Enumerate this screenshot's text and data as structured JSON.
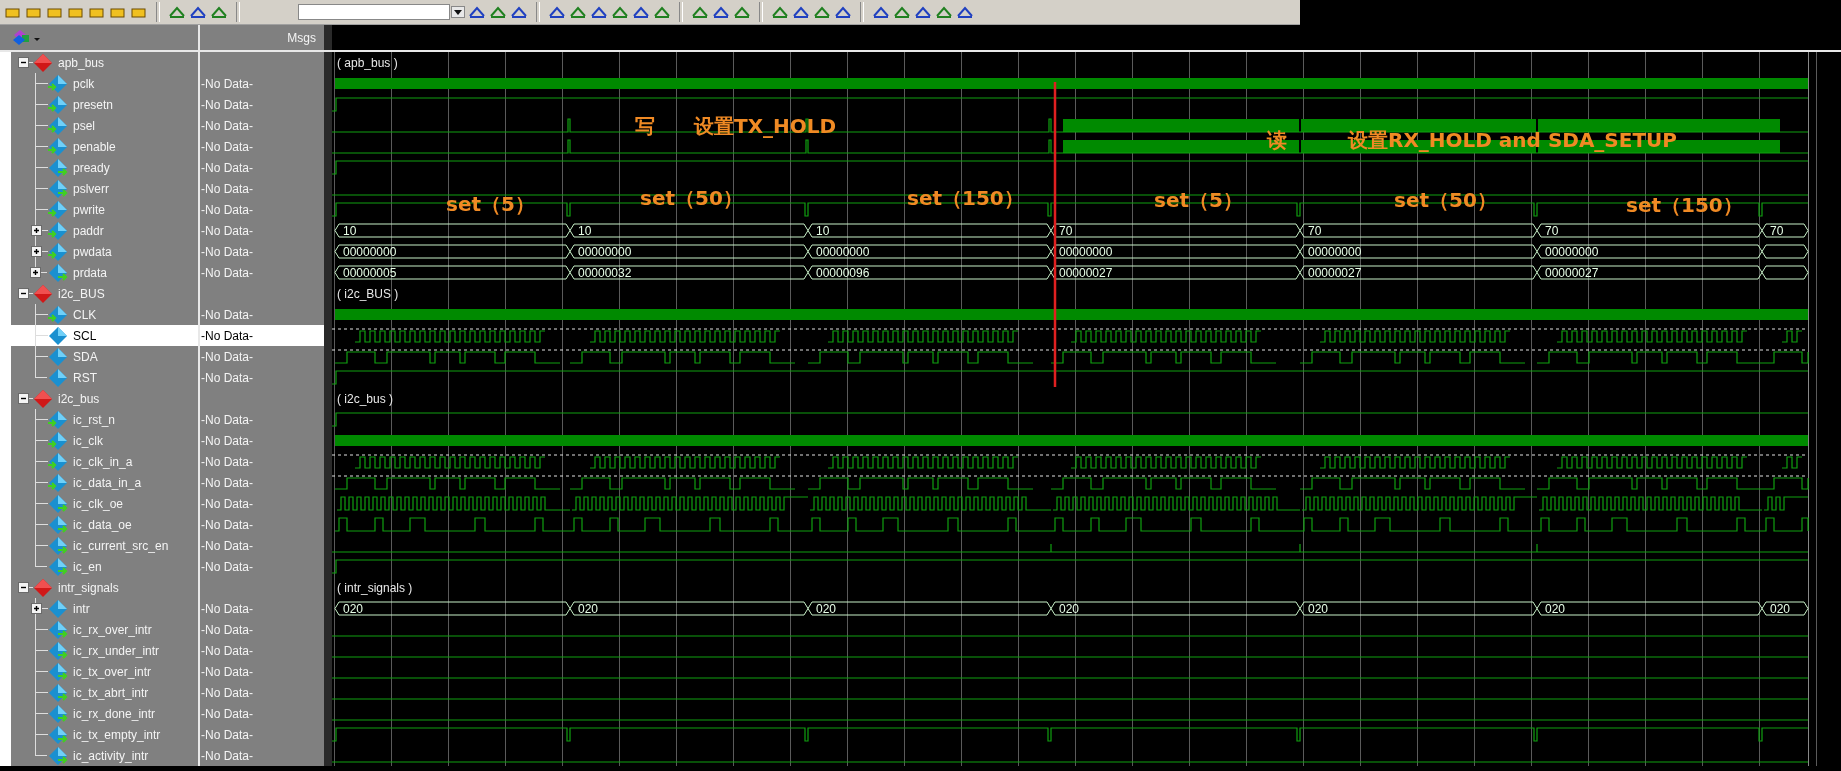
{
  "header": {
    "msgs_label": "Msgs"
  },
  "groups": [
    {
      "name": "apb_bus",
      "expanded": true,
      "selected": false,
      "wave_label": "( apb_bus )",
      "signals": [
        {
          "name": "pclk",
          "icon": {
            "kind": "in"
          },
          "msg": "-No Data-",
          "selected": false,
          "wave": {
            "kind": "clock"
          }
        },
        {
          "name": "presetn",
          "icon": {
            "kind": "in"
          },
          "msg": "-No Data-",
          "selected": false,
          "wave": {
            "kind": "high"
          }
        },
        {
          "name": "psel",
          "icon": {
            "kind": "in"
          },
          "msg": "-No Data-",
          "selected": false,
          "wave": {
            "kind": "strobe"
          }
        },
        {
          "name": "penable",
          "icon": {
            "kind": "in"
          },
          "msg": "-No Data-",
          "selected": false,
          "wave": {
            "kind": "strobe"
          }
        },
        {
          "name": "pready",
          "icon": {
            "kind": "out"
          },
          "msg": "-No Data-",
          "selected": false,
          "wave": {
            "kind": "high"
          }
        },
        {
          "name": "pslverr",
          "icon": {
            "kind": "out"
          },
          "msg": "-No Data-",
          "selected": false,
          "wave": {
            "kind": "low"
          }
        },
        {
          "name": "pwrite",
          "icon": {
            "kind": "in"
          },
          "msg": "-No Data-",
          "selected": false,
          "wave": {
            "kind": "dips"
          }
        },
        {
          "name": "paddr",
          "icon": {
            "kind": "in"
          },
          "msg": "-No Data-",
          "selected": false,
          "expanded": false,
          "wave": {
            "kind": "bus"
          },
          "values": [
            "10",
            "10",
            "10",
            "70",
            "70",
            "70",
            "70"
          ]
        },
        {
          "name": "pwdata",
          "icon": {
            "kind": "in"
          },
          "msg": "-No Data-",
          "selected": false,
          "expanded": false,
          "wave": {
            "kind": "bus"
          },
          "values": [
            "00000000",
            "00000000",
            "00000000",
            "00000000",
            "00000000",
            "00000000"
          ]
        },
        {
          "name": "prdata",
          "icon": {
            "kind": "out"
          },
          "msg": "-No Data-",
          "selected": false,
          "expanded": false,
          "wave": {
            "kind": "bus"
          },
          "values": [
            "00000005",
            "00000032",
            "00000096",
            "00000027",
            "00000027",
            "00000027"
          ]
        }
      ]
    },
    {
      "name": "i2c_BUS",
      "expanded": true,
      "selected": false,
      "wave_label": "( i2c_BUS )",
      "signals": [
        {
          "name": "CLK",
          "icon": {
            "kind": "in"
          },
          "msg": "-No Data-",
          "selected": false,
          "wave": {
            "kind": "clock"
          }
        },
        {
          "name": "SCL",
          "icon": {
            "kind": "internal"
          },
          "msg": "-No Data-",
          "selected": true,
          "wave": {
            "kind": "scl"
          }
        },
        {
          "name": "SDA",
          "icon": {
            "kind": "internal"
          },
          "msg": "-No Data-",
          "selected": false,
          "wave": {
            "kind": "sda"
          }
        },
        {
          "name": "RST",
          "icon": {
            "kind": "internal"
          },
          "msg": "-No Data-",
          "selected": false,
          "wave": {
            "kind": "high"
          }
        }
      ]
    },
    {
      "name": "i2c_bus",
      "expanded": true,
      "selected": false,
      "wave_label": "( i2c_bus )",
      "signals": [
        {
          "name": "ic_rst_n",
          "icon": {
            "kind": "in"
          },
          "msg": "-No Data-",
          "selected": false,
          "wave": {
            "kind": "high"
          }
        },
        {
          "name": "ic_clk",
          "icon": {
            "kind": "in"
          },
          "msg": "-No Data-",
          "selected": false,
          "wave": {
            "kind": "clock"
          }
        },
        {
          "name": "ic_clk_in_a",
          "icon": {
            "kind": "in"
          },
          "msg": "-No Data-",
          "selected": false,
          "wave": {
            "kind": "scl"
          }
        },
        {
          "name": "ic_data_in_a",
          "icon": {
            "kind": "in"
          },
          "msg": "-No Data-",
          "selected": false,
          "wave": {
            "kind": "sda"
          }
        },
        {
          "name": "ic_clk_oe",
          "icon": {
            "kind": "out"
          },
          "msg": "-No Data-",
          "selected": false,
          "wave": {
            "kind": "bursts"
          }
        },
        {
          "name": "ic_data_oe",
          "icon": {
            "kind": "out"
          },
          "msg": "-No Data-",
          "selected": false,
          "wave": {
            "kind": "pulses"
          }
        },
        {
          "name": "ic_current_src_en",
          "icon": {
            "kind": "out"
          },
          "msg": "-No Data-",
          "selected": false,
          "wave": {
            "kind": "ticks"
          }
        },
        {
          "name": "ic_en",
          "icon": {
            "kind": "out"
          },
          "msg": "-No Data-",
          "selected": false,
          "wave": {
            "kind": "high"
          }
        }
      ]
    },
    {
      "name": "intr_signals",
      "expanded": true,
      "selected": false,
      "wave_label": "( intr_signals )",
      "signals": [
        {
          "name": "intr",
          "icon": {
            "kind": "internal"
          },
          "msg": "-No Data-",
          "selected": false,
          "expanded": false,
          "wave": {
            "kind": "bus"
          },
          "values": [
            "020",
            "020",
            "020",
            "020",
            "020",
            "020",
            "020"
          ]
        },
        {
          "name": "ic_rx_over_intr",
          "icon": {
            "kind": "out"
          },
          "msg": "-No Data-",
          "selected": false,
          "wave": {
            "kind": "low"
          }
        },
        {
          "name": "ic_rx_under_intr",
          "icon": {
            "kind": "out"
          },
          "msg": "-No Data-",
          "selected": false,
          "wave": {
            "kind": "low"
          }
        },
        {
          "name": "ic_tx_over_intr",
          "icon": {
            "kind": "out"
          },
          "msg": "-No Data-",
          "selected": false,
          "wave": {
            "kind": "low"
          }
        },
        {
          "name": "ic_tx_abrt_intr",
          "icon": {
            "kind": "out"
          },
          "msg": "-No Data-",
          "selected": false,
          "wave": {
            "kind": "low"
          }
        },
        {
          "name": "ic_rx_done_intr",
          "icon": {
            "kind": "out"
          },
          "msg": "-No Data-",
          "selected": false,
          "wave": {
            "kind": "low"
          }
        },
        {
          "name": "ic_tx_empty_intr",
          "icon": {
            "kind": "out"
          },
          "msg": "-No Data-",
          "selected": false,
          "wave": {
            "kind": "dips"
          }
        },
        {
          "name": "ic_activity_intr",
          "icon": {
            "kind": "out"
          },
          "msg": "-No Data-",
          "selected": false,
          "wave": {
            "kind": "low"
          }
        }
      ]
    }
  ],
  "annotations": [
    {
      "text": "写"
    },
    {
      "text": "设置TX_HOLD"
    },
    {
      "text": "读"
    },
    {
      "text": "设置RX_HOLD  and  SDA_SETUP"
    },
    {
      "text": "set（5）"
    },
    {
      "text": "set（50）"
    },
    {
      "text": "set（150）"
    },
    {
      "text": "set（5）"
    },
    {
      "text": "set（50）"
    },
    {
      "text": "set（150）"
    }
  ]
}
